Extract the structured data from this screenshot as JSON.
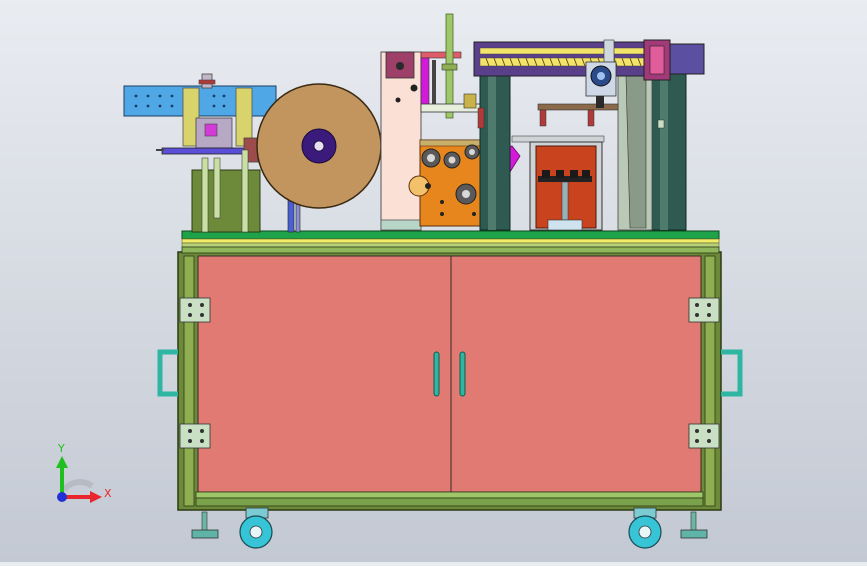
{
  "viewport": {
    "background_top": "#e9ecf1",
    "background_bottom": "#c3c9d3"
  },
  "triad": {
    "y_label": "Y",
    "x_label": "X",
    "y_color": "#1fbf1f",
    "x_color": "#e8262b",
    "z_color": "#2330d6"
  },
  "colors": {
    "cabinet_frame": "#6d8a3b",
    "cabinet_door": "#e07a72",
    "tabletop": "#b8d07a",
    "handle": "#2fb6a2",
    "paper_roll": "#c2955f",
    "roll_hub": "#3a1a7a",
    "orange_block": "#e8861e",
    "accent_magenta": "#d21ad8",
    "blue_rail": "#4fa7e6",
    "dark_column": "#2f5a52",
    "screw_rail": "#f2e46b",
    "caster": "#36c4d6"
  }
}
